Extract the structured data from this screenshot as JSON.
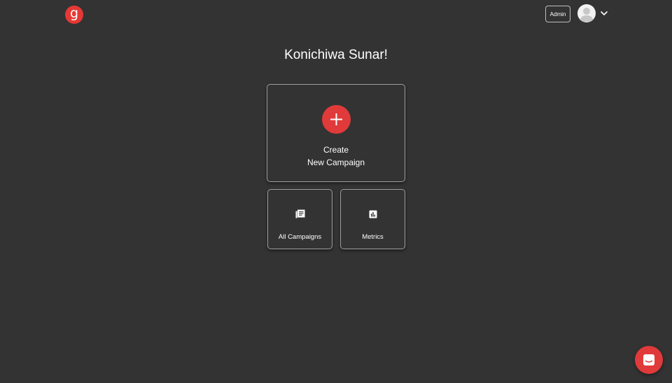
{
  "header": {
    "logo_letter": "g",
    "admin_label": "Admin",
    "avatar_icon": "user-avatar-icon",
    "menu_icon": "chevron-down-icon"
  },
  "main": {
    "greeting": "Konichiwa Sunar!",
    "create_card": {
      "icon": "plus-icon",
      "line1": "Create",
      "line2": "New Campaign"
    },
    "small_cards": [
      {
        "icon": "campaigns-list-icon",
        "label": "All Campaigns"
      },
      {
        "icon": "bar-chart-icon",
        "label": "Metrics"
      }
    ]
  },
  "chat": {
    "icon": "chat-icon"
  },
  "colors": {
    "background": "#333333",
    "accent": "#e03a3a",
    "border": "#9e9e9e",
    "text": "#ffffff"
  }
}
